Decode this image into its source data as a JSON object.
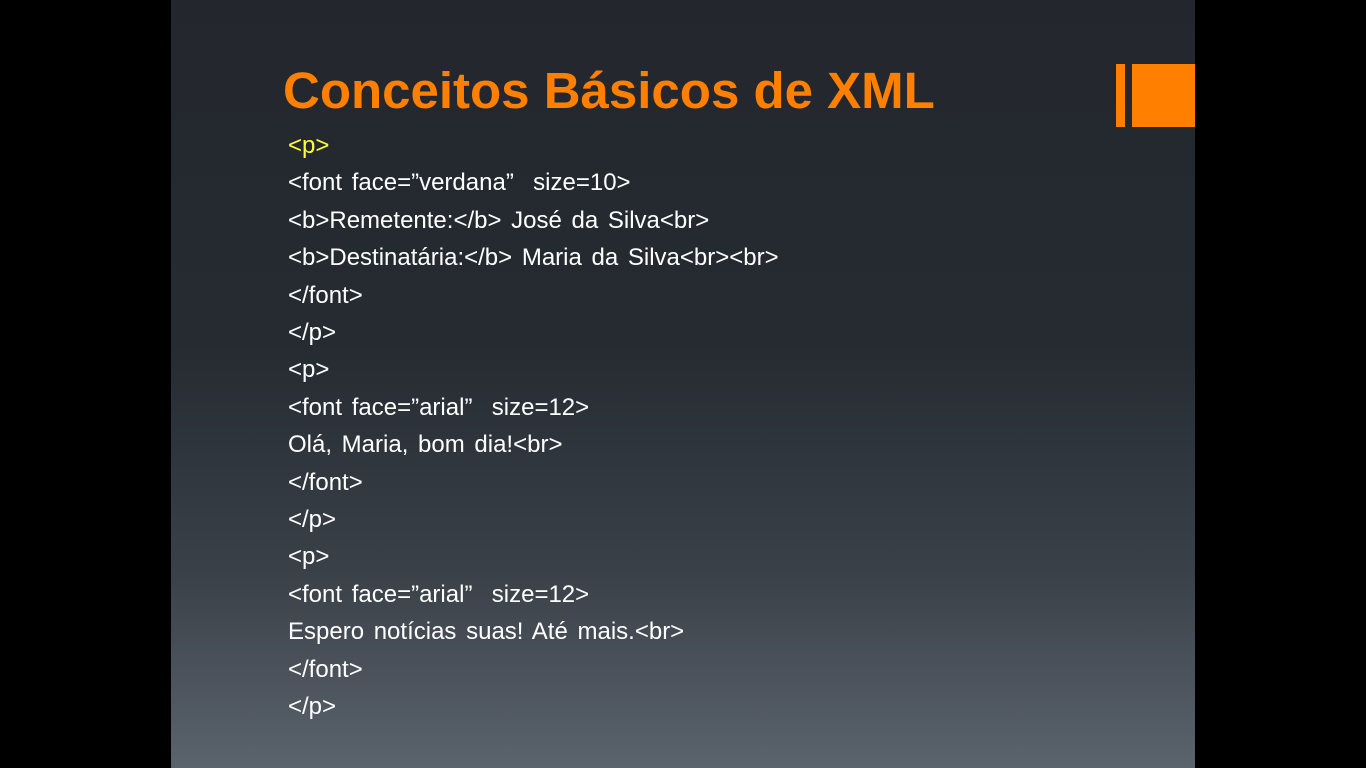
{
  "slide": {
    "title": "Conceitos Básicos de XML",
    "accent_color": "#ff8000",
    "highlight_color": "#ffff33",
    "lines": [
      "<p>",
      "<font face=”verdana”  size=10>",
      "<b>Remetente:</b> José da Silva<br>",
      "<b>Destinatária:</b> Maria da Silva<br><br>",
      "</font>",
      "</p>",
      "<p>",
      "<font face=”arial”  size=12>",
      "Olá, Maria, bom dia!<br>",
      "</font>",
      "</p>",
      "<p>",
      "<font face=”arial”  size=12>",
      "Espero notícias suas! Até mais.<br>",
      "</font>",
      "</p>"
    ]
  }
}
